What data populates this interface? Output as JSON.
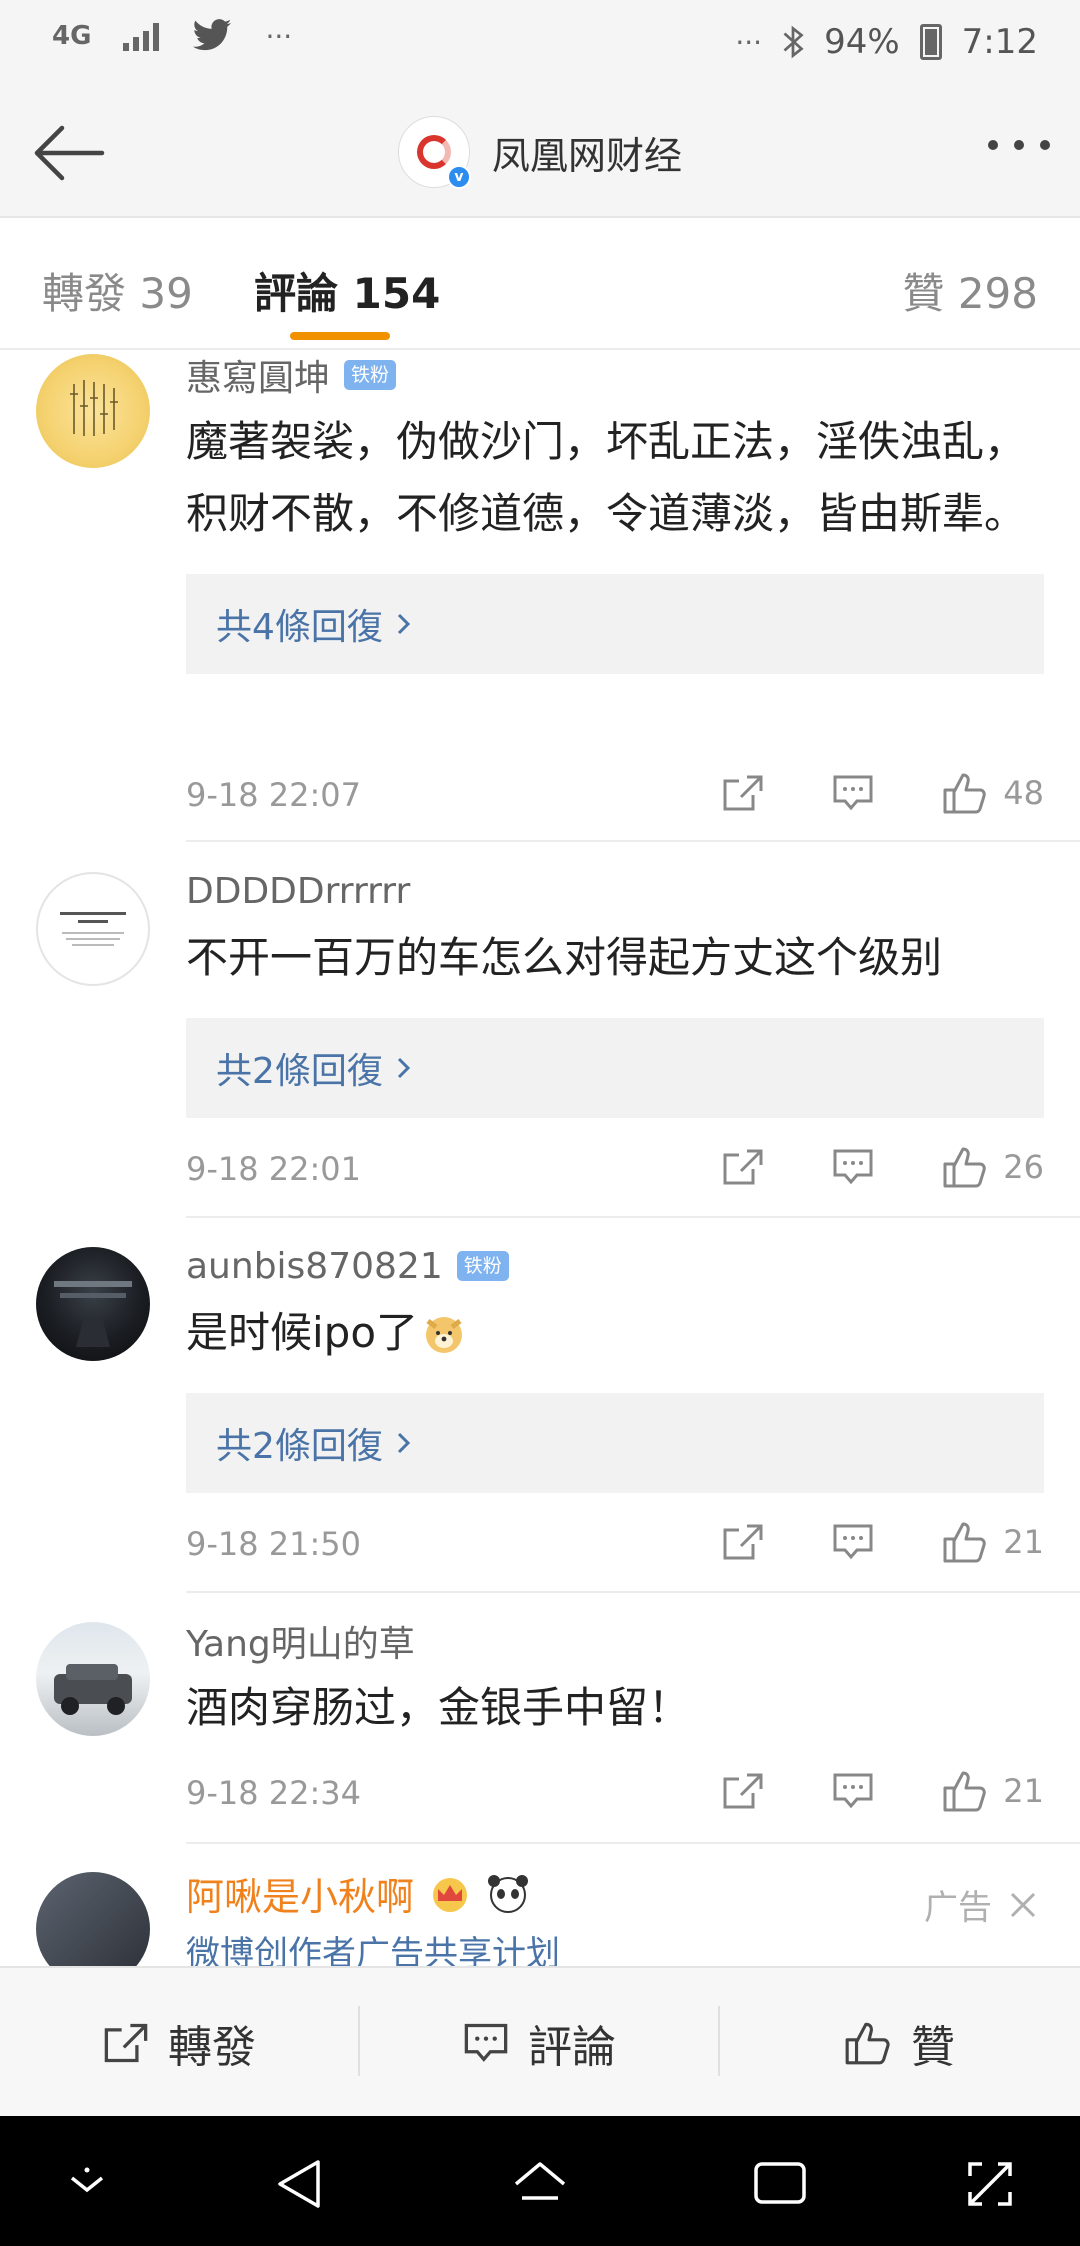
{
  "status_bar": {
    "network": "4G",
    "battery": "94%",
    "time": "7:12",
    "icons": [
      "signal-icon",
      "twitter-icon",
      "overflow-icon",
      "bluetooth-icon",
      "battery-icon"
    ]
  },
  "nav": {
    "title": "凤凰网财经",
    "back_icon": "back-arrow-icon",
    "more_icon": "more-icon"
  },
  "tabs": {
    "repost": "轉發 39",
    "comments": "評論 154",
    "likes": "贊 298"
  },
  "colors": {
    "accent": "#f29100",
    "link": "#4a74a8",
    "badge": "#7fb3f0",
    "ad_name": "#f0821e"
  },
  "comments": [
    {
      "name": "惠寫圓坤",
      "badge": "铁粉",
      "text": "魔著袈裟，伪做沙门，坏乱正法，淫佚浊乱，积财不散，不修道德，令道薄淡，皆由斯辈。",
      "replies": "共4條回復",
      "time": "9-18 22:07",
      "likes": "48"
    },
    {
      "name": "DDDDDrrrrrr",
      "badge": "",
      "text": "不开一百万的车怎么对得起方丈这个级别",
      "replies": "共2條回復",
      "time": "9-18 22:01",
      "likes": "26"
    },
    {
      "name": "aunbis870821",
      "badge": "铁粉",
      "text": "是时候ipo了",
      "replies": "共2條回復",
      "time": "9-18 21:50",
      "likes": "21"
    },
    {
      "name": "Yang明山的草",
      "badge": "",
      "text": "酒肉穿肠过，金银手中留！",
      "replies": "",
      "time": "9-18 22:34",
      "likes": "21"
    }
  ],
  "ad": {
    "name": "阿啾是小秋啊",
    "subtitle": "微博创作者广告共享计划",
    "label": "广告"
  },
  "bottom_bar": {
    "repost": "轉發",
    "comment": "評論",
    "like": "贊"
  }
}
